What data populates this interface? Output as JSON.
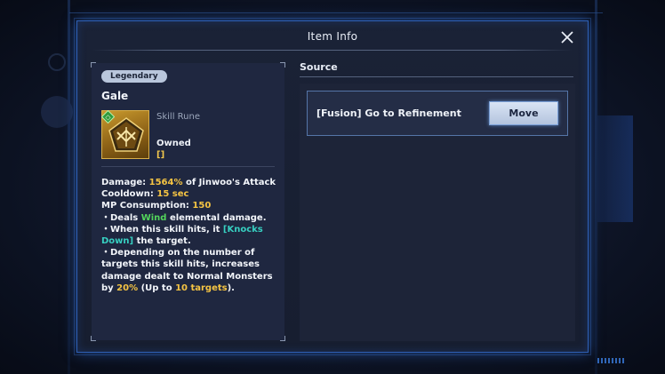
{
  "modal": {
    "title": "Item Info",
    "close_icon": "close-icon"
  },
  "item": {
    "rarity": "Legendary",
    "name": "Gale",
    "type": "Skill Rune",
    "owned_label": "Owned",
    "owned_count": "[]",
    "icon": "skill-rune-icon",
    "colors": {
      "rarity_badge": "#b9c6dc",
      "highlight_yellow": "#f5c443",
      "wind_green": "#53d45b",
      "status_cyan": "#37cfc1"
    }
  },
  "description": {
    "damage_label": "Damage:",
    "damage_value": "1564%",
    "damage_suffix": "of Jinwoo's Attack",
    "cooldown_label": "Cooldown:",
    "cooldown_value": "15 sec",
    "mp_label": "MP Consumption:",
    "mp_value": "150",
    "line1_prefix": "・Deals",
    "line1_element": "Wind",
    "line1_suffix": "elemental damage.",
    "line2_prefix": "・When this skill hits, it",
    "line2_status": "[Knocks Down]",
    "line2_suffix": "the target.",
    "line3_prefix": "・Depending on the number of targets this skill hits, increases damage dealt to Normal Monsters by",
    "line3_value": "20%",
    "line3_mid": "(Up to",
    "line3_targets": "10 targets",
    "line3_suffix": ")."
  },
  "source": {
    "title": "Source",
    "rows": [
      {
        "label": "[Fusion] Go to Refinement",
        "button": "Move"
      }
    ]
  }
}
